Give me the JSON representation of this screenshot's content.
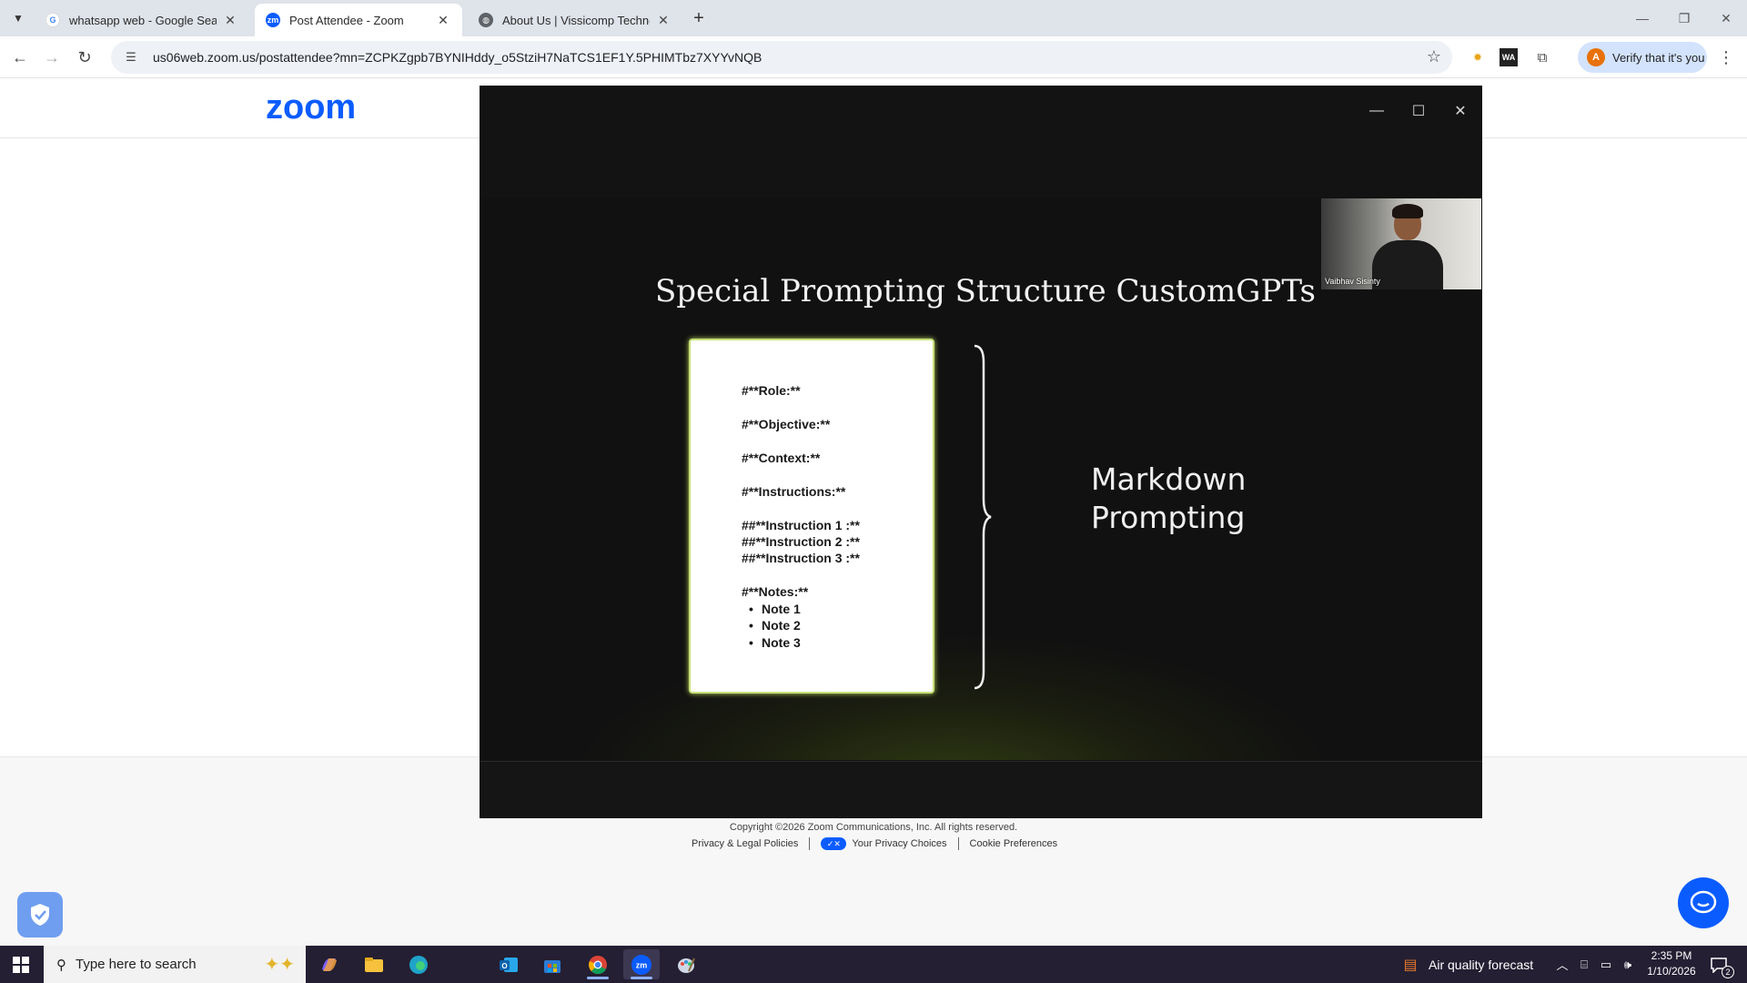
{
  "browser": {
    "tabs": [
      {
        "title": "whatsapp web - Google Search",
        "favicon": "google-icon",
        "active": false
      },
      {
        "title": "Post Attendee - Zoom",
        "favicon": "zoom-icon",
        "active": true
      },
      {
        "title": "About Us | Vissicomp Technolo",
        "favicon": "globe-icon",
        "active": false
      }
    ],
    "url": "us06web.zoom.us/postattendee?mn=ZCPKZgpb7BYNIHddy_o5StziH7NaTCS1EF1Y.5PHIMTbz7XYYvNQB",
    "verify_label": "Verify that it's you",
    "verify_avatar": "A",
    "extensions": [
      "honey-icon",
      "wa-icon",
      "puzzle-icon"
    ]
  },
  "page": {
    "logo": "zoom",
    "copyright": "Copyright ©2026 Zoom Communications, Inc. All rights reserved.",
    "links": [
      "Privacy & Legal Policies",
      "Your Privacy Choices",
      "Cookie Preferences"
    ]
  },
  "meeting": {
    "slide_title": "Special Prompting Structure CustomGPTs",
    "code_lines": [
      "#**Role:**",
      "#**Objective:**",
      "#**Context:**",
      "#**Instructions:**",
      "##**Instruction 1 :**",
      "##**Instruction 2 :**",
      "##**Instruction 3 :**",
      "#**Notes:**"
    ],
    "notes": [
      "Note 1",
      "Note 2",
      "Note 3"
    ],
    "side_label_line1": "Markdown",
    "side_label_line2": "Prompting",
    "participant_name": "Vaibhav Sisinty"
  },
  "taskbar": {
    "search_placeholder": "Type here to search",
    "apps": [
      "copilot-icon",
      "file-explorer-icon",
      "edge-icon",
      "outlook-icon",
      "store-icon",
      "chrome-icon",
      "zoom-icon",
      "paint-icon"
    ],
    "weather": "Air quality forecast",
    "time": "2:35 PM",
    "date": "1/10/2026",
    "notification_count": "2"
  },
  "colors": {
    "zoom_blue": "#0b5cff",
    "taskbar": "#241f33",
    "slide_border": "#c8e07a"
  }
}
